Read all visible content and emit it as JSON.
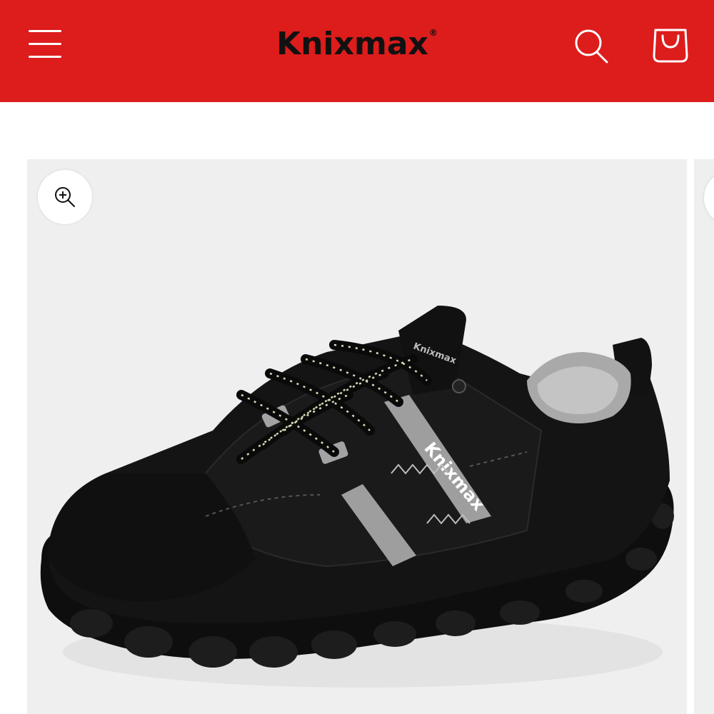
{
  "header": {
    "background": "#dd1c1c",
    "brand": "Knixmax",
    "brand_mark": "®",
    "icons": {
      "menu": "hamburger-icon",
      "search": "search-icon",
      "cart": "shopping-bag-icon"
    }
  },
  "gallery": {
    "background": "#efefef",
    "zoom_icon": "zoom-in-icon",
    "product_image": {
      "subject": "black suede lace-up sneaker with grey accents",
      "side_branding": "Knixmax",
      "tongue_branding": "Knixmax"
    }
  }
}
